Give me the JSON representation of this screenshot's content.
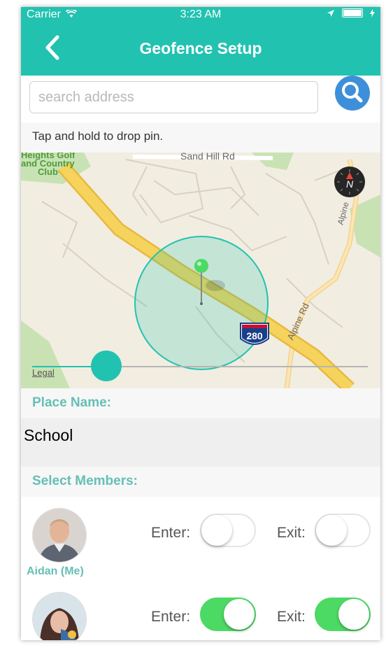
{
  "status_bar": {
    "carrier": "Carrier",
    "time": "3:23 AM"
  },
  "nav": {
    "title": "Geofence Setup"
  },
  "search": {
    "placeholder": "search address",
    "value": ""
  },
  "hint": "Tap and hold to drop pin.",
  "map": {
    "labels": {
      "road_top": "Sand Hill Rd",
      "golf": [
        "Heights Golf",
        "and Country",
        "Club"
      ],
      "alpine_top": "Alpine",
      "alpine_bottom": "Alpine Rd",
      "interstate": "280"
    },
    "compass_letter": "N",
    "legal": "Legal",
    "radius_slider": {
      "value": 0.22
    }
  },
  "place": {
    "header": "Place Name:",
    "value": "School"
  },
  "members": {
    "header": "Select Members:",
    "enter_label": "Enter:",
    "exit_label": "Exit:",
    "list": [
      {
        "name": "Aidan (Me)",
        "enter": false,
        "exit": false
      },
      {
        "name": "",
        "enter": true,
        "exit": true
      }
    ]
  },
  "colors": {
    "accent": "#22c2b0",
    "search_button": "#3d8fd9",
    "toggle_on": "#4cd964",
    "section_text": "#66bfb5"
  },
  "icons": {
    "back": "chevron-left-icon",
    "search": "magnifier-icon",
    "location": "location-arrow-icon",
    "wifi": "wifi-icon",
    "battery": "battery-icon"
  }
}
